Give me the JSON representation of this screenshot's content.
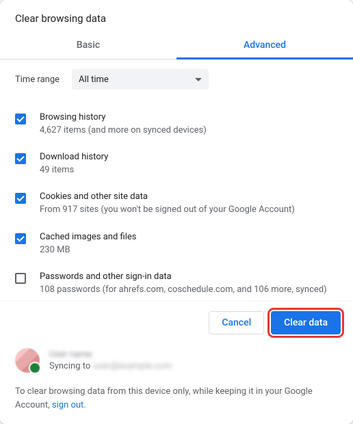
{
  "title": "Clear browsing data",
  "tabs": {
    "basic": "Basic",
    "advanced": "Advanced"
  },
  "time": {
    "label": "Time range",
    "selected": "All time"
  },
  "items": [
    {
      "checked": true,
      "title": "Browsing history",
      "desc": "4,627 items (and more on synced devices)"
    },
    {
      "checked": true,
      "title": "Download history",
      "desc": "49 items"
    },
    {
      "checked": true,
      "title": "Cookies and other site data",
      "desc": "From 917 sites (you won't be signed out of your Google Account)"
    },
    {
      "checked": true,
      "title": "Cached images and files",
      "desc": "230 MB"
    },
    {
      "checked": false,
      "title": "Passwords and other sign-in data",
      "desc": "108 passwords (for ahrefs.com, coschedule.com, and 106 more, synced)"
    }
  ],
  "buttons": {
    "cancel": "Cancel",
    "clear": "Clear data"
  },
  "account": {
    "name": "User name",
    "syncing_prefix": "Syncing to ",
    "email": "user@example.com"
  },
  "note_prefix": "To clear browsing data from this device only, while keeping it in your Google Account, ",
  "note_link": "sign out",
  "note_suffix": "."
}
